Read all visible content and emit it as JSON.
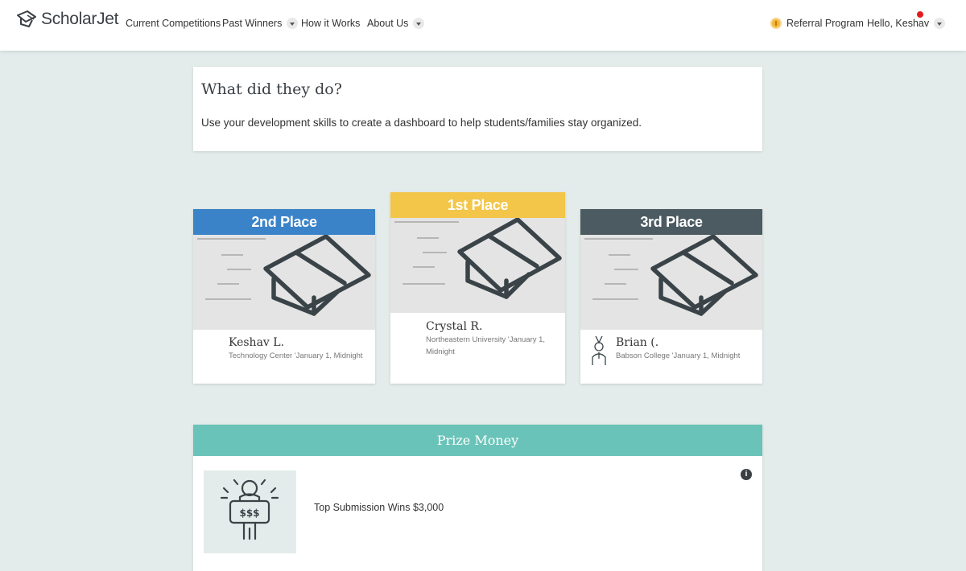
{
  "header": {
    "logo_text": "ScholarJet",
    "nav": [
      {
        "label": "Current Competitions"
      },
      {
        "label": "Past Winners"
      },
      {
        "label": "How it Works"
      },
      {
        "label": "About Us"
      }
    ],
    "referral_label": "Referral Program",
    "greeting": "Hello, Keshav"
  },
  "info": {
    "title": "What did they do?",
    "description": "Use your development skills to create a dashboard to help students/families stay organized."
  },
  "winners": {
    "second": {
      "place": "2nd Place",
      "name": "Keshav L.",
      "details": "Technology Center 'January 1, Midnight",
      "color": "#3a83c9"
    },
    "first": {
      "place": "1st Place",
      "name": "Crystal R.",
      "details": "Northeastern University 'January 1, Midnight",
      "color": "#f3c64a"
    },
    "third": {
      "place": "3rd Place",
      "name": "Brian (.",
      "details": "Babson College 'January 1, Midnight",
      "color": "#4b5b61"
    }
  },
  "prize": {
    "header": "Prize Money",
    "text": "Top Submission Wins $3,000",
    "icon_symbol": "$$$",
    "info_icon": "i"
  },
  "colors": {
    "background": "#e3ecea",
    "prize_header": "#6ac3b8",
    "icon_dark": "#3a4448"
  }
}
